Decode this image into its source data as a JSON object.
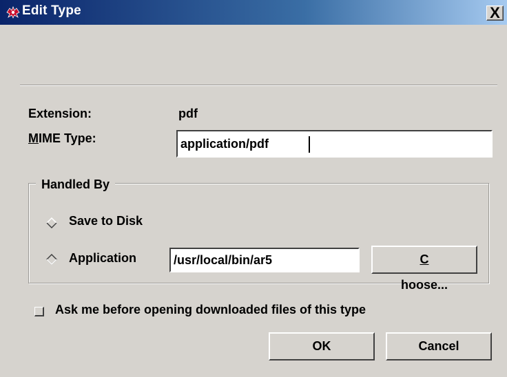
{
  "window": {
    "title": "Edit Type",
    "close_label": "X"
  },
  "form": {
    "extension_label": "Extension:",
    "extension_value": "pdf",
    "mime_label_mnemonic": "M",
    "mime_label_rest": "IME Type:",
    "mime_value": "application/pdf"
  },
  "handled_by": {
    "legend": "Handled By",
    "save_to_disk_label": "Save to Disk",
    "application_label": "Application",
    "application_path": "/usr/local/bin/ar5",
    "choose_mnemonic": "C",
    "choose_rest": "hoose...",
    "selected": "application"
  },
  "ask_checkbox": {
    "label": "Ask me before opening downloaded files of this type",
    "checked": false
  },
  "buttons": {
    "ok": "OK",
    "cancel": "Cancel"
  },
  "colors": {
    "titlebar_start": "#0a246a",
    "titlebar_end": "#a6caf0",
    "dialog_bg": "#d6d3ce"
  }
}
